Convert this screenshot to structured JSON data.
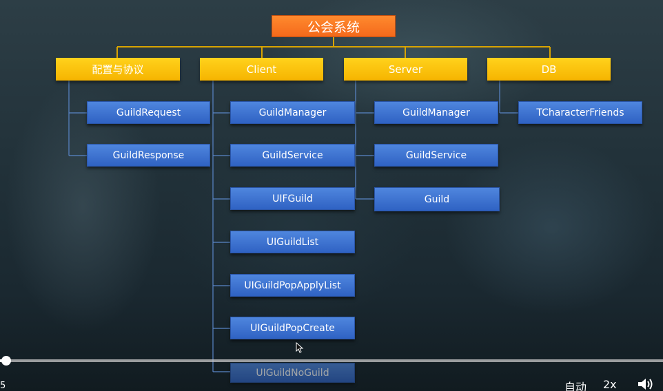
{
  "diagram": {
    "title": "公会系统",
    "categories": [
      {
        "label": "配置与协议",
        "items": [
          "GuildRequest",
          "GuildResponse"
        ]
      },
      {
        "label": "Client",
        "items": [
          "GuildManager",
          "GuildService",
          "UIFGuild",
          "UIGuildList",
          "UIGuildPopApplyList",
          "UIGuildPopCreate",
          "UIGuildNoGuild"
        ]
      },
      {
        "label": "Server",
        "items": [
          "GuildManager",
          "GuildService",
          "Guild"
        ]
      },
      {
        "label": "DB",
        "items": [
          "TCharacterFriends"
        ]
      }
    ],
    "colors": {
      "title": "#f4691b",
      "category": "#f6b400",
      "item": "#3a6fcf",
      "connector": "#d9a400"
    }
  },
  "player": {
    "time": "5",
    "auto_label": "自动",
    "speed_label": "2x",
    "progress": 0.01,
    "volume_icon": "speaker-icon"
  }
}
